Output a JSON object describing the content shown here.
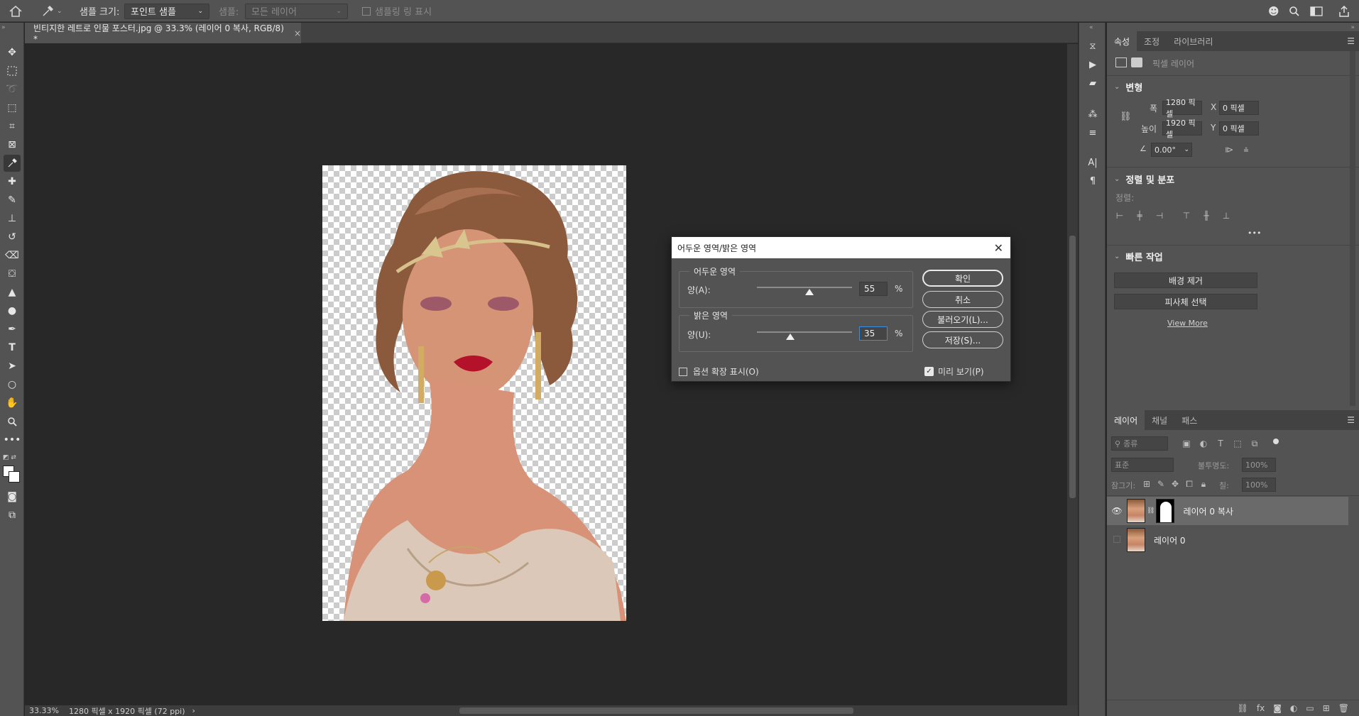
{
  "options_bar": {
    "sample_size_label": "샘플 크기:",
    "sample_size_value": "포인트 샘플",
    "sample_label": "샘플:",
    "sample_value": "모든 레이어",
    "show_ring_label": "샘플링 링 표시"
  },
  "document": {
    "tab_title": "빈티지한 레트로 인물 포스터.jpg @ 33.3% (레이어 0 복사, RGB/8) *",
    "close_glyph": "×"
  },
  "status": {
    "zoom": "33.33%",
    "doc_info": "1280 픽셀 x 1920 픽셀 (72 ppi)",
    "arrow": "›"
  },
  "properties_panel": {
    "tabs": [
      "속성",
      "조정",
      "라이브러리"
    ],
    "layer_type": "픽셀 레이어",
    "transform": {
      "title": "변형",
      "width_label": "폭",
      "width_value": "1280 픽셀",
      "height_label": "높이",
      "height_value": "1920 픽셀",
      "x_label": "X",
      "x_value": "0 픽셀",
      "y_label": "Y",
      "y_value": "0 픽셀",
      "angle_value": "0.00°"
    },
    "align": {
      "title": "정렬 및 분포",
      "sub_label": "정렬:",
      "more": "•••"
    },
    "quick_actions": {
      "title": "빠른 작업",
      "remove_bg": "배경 제거",
      "select_subject": "피사체 선택",
      "view_more": "View More"
    }
  },
  "layers_panel": {
    "tabs": [
      "레이어",
      "채널",
      "패스"
    ],
    "filter_placeholder": "종류",
    "blend_mode": "표준",
    "opacity_label": "불투명도:",
    "opacity_value": "100%",
    "lock_label": "잠그기:",
    "fill_label": "칠:",
    "fill_value": "100%",
    "layers": [
      {
        "name": "레이어 0 복사",
        "visible": true,
        "selected": true,
        "has_mask": true
      },
      {
        "name": "레이어 0",
        "visible": false,
        "selected": false,
        "has_mask": false
      }
    ]
  },
  "dialog": {
    "title": "어두운 영역/밝은 영역",
    "shadows": {
      "title": "어두운 영역",
      "amount_label": "양(A):",
      "amount_value": "55",
      "amount_fraction": 0.55,
      "unit": "%"
    },
    "highlights": {
      "title": "밝은 영역",
      "amount_label": "양(U):",
      "amount_value": "35",
      "amount_fraction": 0.35,
      "unit": "%"
    },
    "buttons": {
      "ok": "확인",
      "cancel": "취소",
      "load": "불러오기(L)...",
      "save": "저장(S)..."
    },
    "show_more_options": "옵션 확장 표시(O)",
    "preview": "미리 보기(P)",
    "preview_checked": true,
    "more_options_checked": false
  }
}
